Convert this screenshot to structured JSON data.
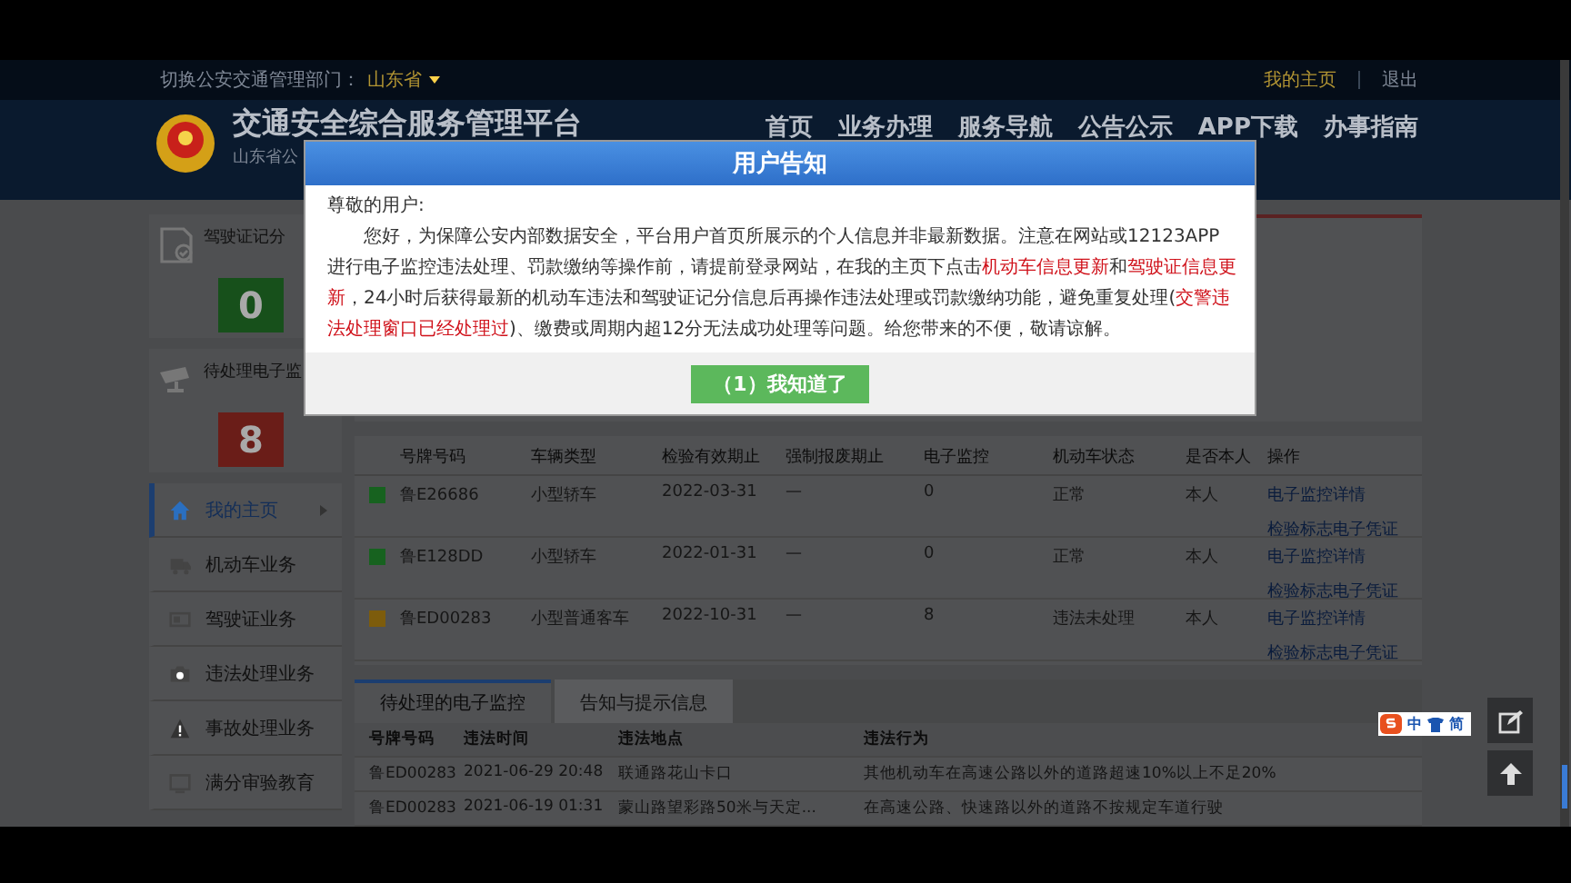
{
  "top_bar": {
    "region_label": "切换公安交通管理部门：",
    "region": "山东省",
    "user_link": "我的主页",
    "logout": "退出"
  },
  "header": {
    "title": "交通安全综合服务管理平台",
    "subtitle": "山东省公",
    "nav": [
      "首页",
      "业务办理",
      "服务导航",
      "公告公示",
      "APP下载",
      "办事指南"
    ]
  },
  "sidebar": {
    "stats": [
      {
        "kind": "license",
        "label": "驾驶证记分",
        "value": "0",
        "color": "#17501b"
      },
      {
        "kind": "camera",
        "label": "待处理电子监",
        "value": "8",
        "color": "#6a1d18"
      }
    ],
    "menu": [
      {
        "kind": "home",
        "label": "我的主页",
        "selected": true
      },
      {
        "kind": "truck",
        "label": "机动车业务",
        "selected": false
      },
      {
        "kind": "card",
        "label": "驾驶证业务",
        "selected": false
      },
      {
        "kind": "camera",
        "label": "违法处理业务",
        "selected": false
      },
      {
        "kind": "warning",
        "label": "事故处理业务",
        "selected": false
      },
      {
        "kind": "monitor",
        "label": "满分审验教育",
        "selected": false
      }
    ]
  },
  "vehicles": {
    "columns": [
      "号牌号码",
      "车辆类型",
      "检验有效期止",
      "强制报废期止",
      "电子监控",
      "机动车状态",
      "是否本人",
      "操作"
    ],
    "rows": [
      {
        "color": "#17621f",
        "cells": [
          "鲁E26686",
          "小型轿车",
          "2022-03-31",
          "—",
          "0",
          "正常",
          "本人"
        ],
        "actions": [
          "电子监控详情",
          "检验标志电子凭证"
        ]
      },
      {
        "color": "#17621f",
        "cells": [
          "鲁E128DD",
          "小型轿车",
          "2022-01-31",
          "—",
          "0",
          "正常",
          "本人"
        ],
        "actions": [
          "电子监控详情",
          "检验标志电子凭证"
        ]
      },
      {
        "color": "#7d5c0c",
        "cells": [
          "鲁ED00283",
          "小型普通客车",
          "2022-10-31",
          "—",
          "8",
          "违法未处理",
          "本人"
        ],
        "actions": [
          "电子监控详情",
          "检验标志电子凭证"
        ]
      }
    ]
  },
  "tabs": [
    {
      "label": "待处理的电子监控",
      "selected": true
    },
    {
      "label": "告知与提示信息",
      "selected": false
    }
  ],
  "violations": {
    "columns": [
      "号牌号码",
      "违法时间",
      "违法地点",
      "违法行为"
    ],
    "rows": [
      [
        "鲁ED00283",
        "2021-06-29 20:48",
        "联通路花山卡口",
        "其他机动车在高速公路以外的道路超速10%以上不足20%"
      ],
      [
        "鲁ED00283",
        "2021-06-19 01:31",
        "蒙山路望彩路50米与天定...",
        "在高速公路、快速路以外的道路不按规定车道行驶"
      ]
    ]
  },
  "ime_toolbar": {
    "labels": [
      "中",
      "简"
    ]
  },
  "modal": {
    "title": "用户告知",
    "greeting": "尊敬的用户:",
    "paragraph": [
      {
        "text": "您好，为保障公安内部数据安全，平台用户首页所展示的个人信息并非最新数据。注意在网站或12123APP进行电子监控违法处理、罚款缴纳等操作前，请提前登录网站，在我的主页下点击",
        "highlight": false
      },
      {
        "text": "机动车信息更新",
        "highlight": true
      },
      {
        "text": "和",
        "highlight": false
      },
      {
        "text": "驾驶证信息更新",
        "highlight": true
      },
      {
        "text": "，24小时后获得最新的机动车违法和驾驶证记分信息后再操作违法处理或罚款缴纳功能，避免重复处理(",
        "highlight": false
      },
      {
        "text": "交警违法处理窗口已经处理过",
        "highlight": true
      },
      {
        "text": ")、缴费或周期内超12分无法成功处理等问题。给您带来的不便，敬请谅解。",
        "highlight": false
      }
    ],
    "button": "（1）我知道了"
  }
}
